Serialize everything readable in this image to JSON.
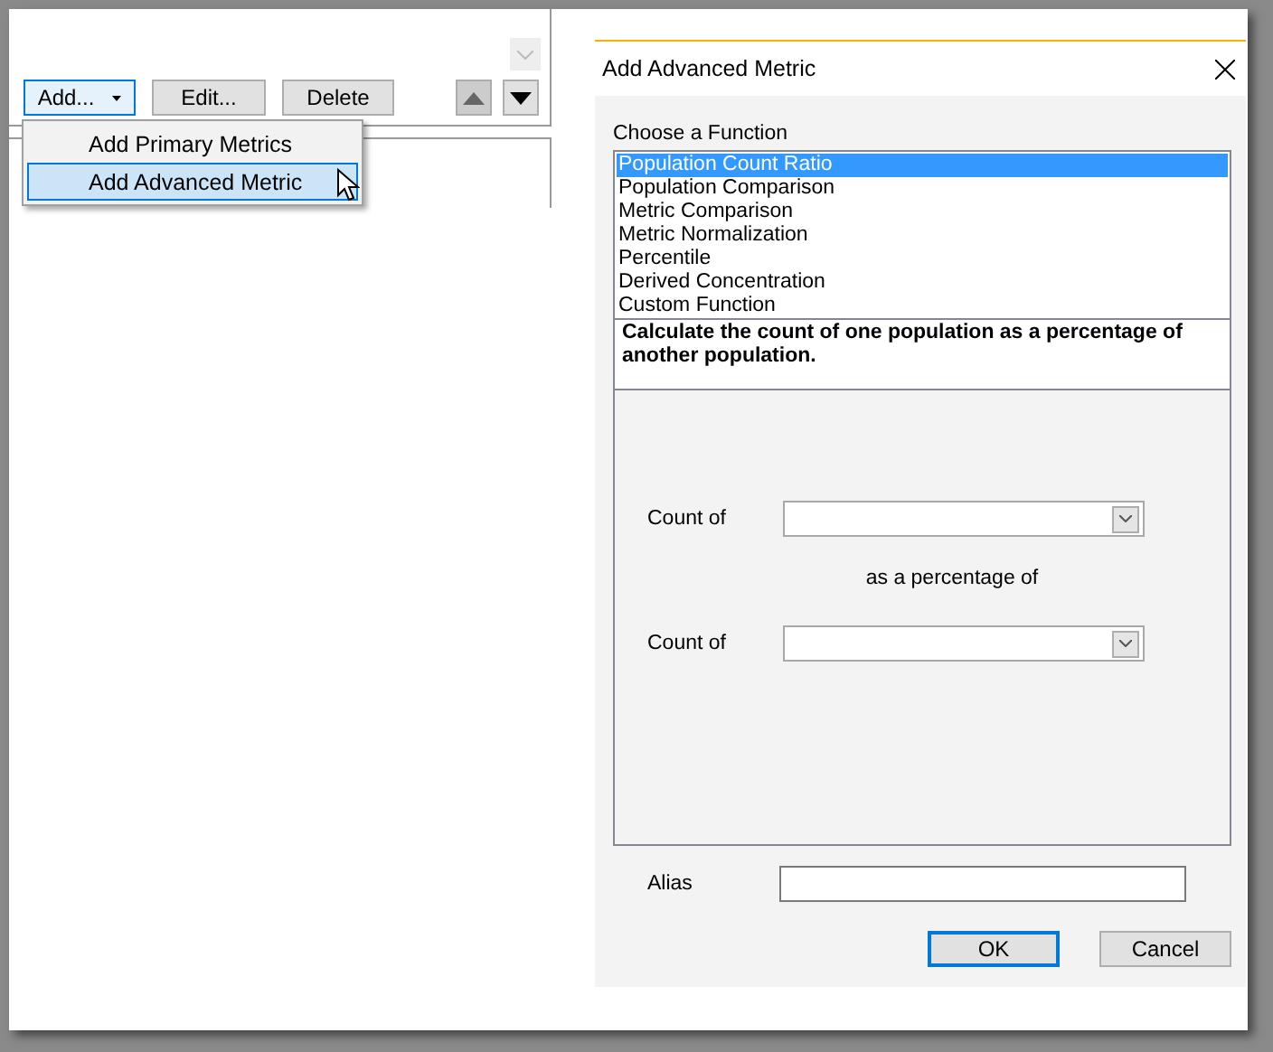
{
  "toolbar": {
    "buttons": [
      {
        "label": "Add...",
        "kind": "dropdown",
        "focused": true
      },
      {
        "label": "Edit...",
        "kind": "plain",
        "focused": false
      },
      {
        "label": "Delete",
        "kind": "plain",
        "focused": false
      }
    ]
  },
  "menu": {
    "items": [
      {
        "label": "Add Primary Metrics",
        "selected": false
      },
      {
        "label": "Add Advanced Metric",
        "selected": true
      }
    ]
  },
  "dialog": {
    "title": "Add Advanced Metric",
    "function_label": "Choose a Function",
    "functions": [
      {
        "label": "Population Count Ratio",
        "selected": true
      },
      {
        "label": "Population Comparison",
        "selected": false
      },
      {
        "label": "Metric Comparison",
        "selected": false
      },
      {
        "label": "Metric Normalization",
        "selected": false
      },
      {
        "label": "Percentile",
        "selected": false
      },
      {
        "label": "Derived Concentration",
        "selected": false
      },
      {
        "label": "Custom Function",
        "selected": false
      }
    ],
    "description": "Calculate the count of one population as a percentage of another population.",
    "fields": [
      {
        "label": "Count of"
      },
      {
        "label": "Count of"
      }
    ],
    "connector": "as a percentage of",
    "alias": {
      "label": "Alias"
    },
    "buttons": [
      {
        "label": "OK",
        "default": true
      },
      {
        "label": "Cancel",
        "default": false
      }
    ]
  }
}
